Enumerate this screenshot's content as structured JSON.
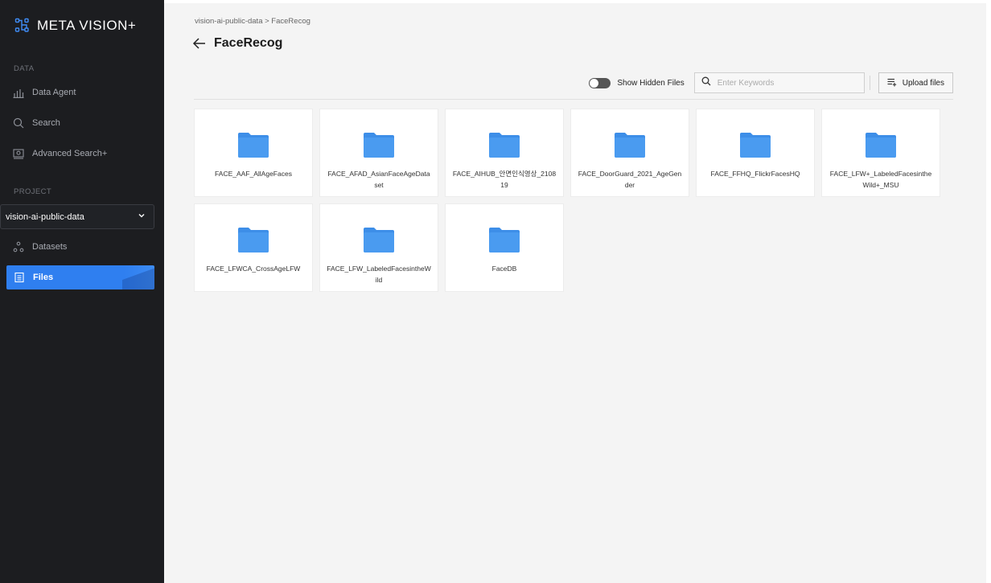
{
  "app": {
    "name": "META VISION+"
  },
  "sidebar": {
    "section_data": "DATA",
    "section_project": "PROJECT",
    "data_items": [
      {
        "label": "Data Agent",
        "icon": "bar-chart-icon"
      },
      {
        "label": "Search",
        "icon": "search-icon"
      },
      {
        "label": "Advanced Search+",
        "icon": "image-search-icon"
      }
    ],
    "project_select": {
      "value": "vision-ai-public-data"
    },
    "project_items": [
      {
        "label": "Datasets",
        "icon": "datasets-icon"
      },
      {
        "label": "Files",
        "icon": "files-icon",
        "active": true
      }
    ]
  },
  "header": {
    "breadcrumb": "vision-ai-public-data > FaceRecog",
    "title": "FaceRecog"
  },
  "toolbar": {
    "show_hidden_label": "Show Hidden Files",
    "show_hidden_on": false,
    "search_placeholder": "Enter Keywords",
    "upload_label": "Upload files"
  },
  "folders": [
    "FACE_AAF_AllAgeFaces",
    "FACE_AFAD_AsianFaceAgeDataset",
    "FACE_AIHUB_안면인식영상_210819",
    "FACE_DoorGuard_2021_AgeGender",
    "FACE_FFHQ_FlickrFacesHQ",
    "FACE_LFW+_LabeledFacesintheWild+_MSU",
    "FACE_LFWCA_CrossAgeLFW",
    "FACE_LFW_LabeledFacesintheWild",
    "FaceDB"
  ],
  "colors": {
    "accent": "#2f7ff0",
    "sidebar_bg": "#1c1d20",
    "folder": "#3d8ee8"
  }
}
